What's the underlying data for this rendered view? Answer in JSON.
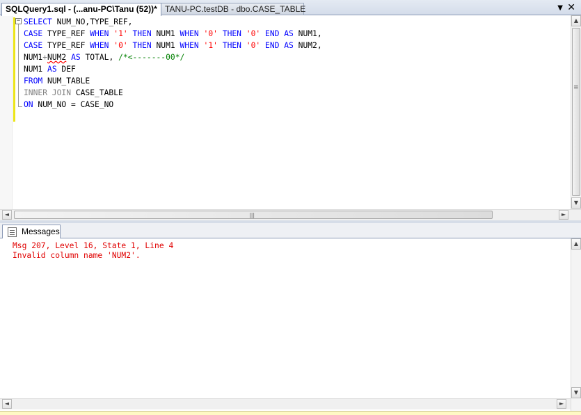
{
  "tabs": {
    "active_label": "SQLQuery1.sql - (...anu-PC\\Tanu (52))*",
    "inactive_label": "TANU-PC.testDB - dbo.CASE_TABLE",
    "dropdown_icon": "chevron-down-icon",
    "close_icon": "close-icon"
  },
  "editor": {
    "outline_glyph": "−",
    "lines": [
      [
        {
          "t": "SELECT",
          "c": "kw"
        },
        {
          "t": " NUM_NO,TYPE_REF,",
          "c": "plain"
        }
      ],
      [
        {
          "t": "CASE",
          "c": "kw"
        },
        {
          "t": " TYPE_REF ",
          "c": "plain"
        },
        {
          "t": "WHEN",
          "c": "kw"
        },
        {
          "t": " ",
          "c": "plain"
        },
        {
          "t": "'1'",
          "c": "str"
        },
        {
          "t": " ",
          "c": "plain"
        },
        {
          "t": "THEN",
          "c": "kw"
        },
        {
          "t": " NUM1 ",
          "c": "plain"
        },
        {
          "t": "WHEN",
          "c": "kw"
        },
        {
          "t": " ",
          "c": "plain"
        },
        {
          "t": "'0'",
          "c": "str"
        },
        {
          "t": " ",
          "c": "plain"
        },
        {
          "t": "THEN",
          "c": "kw"
        },
        {
          "t": " ",
          "c": "plain"
        },
        {
          "t": "'0'",
          "c": "str"
        },
        {
          "t": " ",
          "c": "plain"
        },
        {
          "t": "END",
          "c": "kw"
        },
        {
          "t": " ",
          "c": "plain"
        },
        {
          "t": "AS",
          "c": "kw"
        },
        {
          "t": " NUM1,",
          "c": "plain"
        }
      ],
      [
        {
          "t": "CASE",
          "c": "kw"
        },
        {
          "t": " TYPE_REF ",
          "c": "plain"
        },
        {
          "t": "WHEN",
          "c": "kw"
        },
        {
          "t": " ",
          "c": "plain"
        },
        {
          "t": "'0'",
          "c": "str"
        },
        {
          "t": " ",
          "c": "plain"
        },
        {
          "t": "THEN",
          "c": "kw"
        },
        {
          "t": " NUM1 ",
          "c": "plain"
        },
        {
          "t": "WHEN",
          "c": "kw"
        },
        {
          "t": " ",
          "c": "plain"
        },
        {
          "t": "'1'",
          "c": "str"
        },
        {
          "t": " ",
          "c": "plain"
        },
        {
          "t": "THEN",
          "c": "kw"
        },
        {
          "t": " ",
          "c": "plain"
        },
        {
          "t": "'0'",
          "c": "str"
        },
        {
          "t": " ",
          "c": "plain"
        },
        {
          "t": "END",
          "c": "kw"
        },
        {
          "t": " ",
          "c": "plain"
        },
        {
          "t": "AS",
          "c": "kw"
        },
        {
          "t": " NUM2,",
          "c": "plain"
        }
      ],
      [
        {
          "t": "NUM1",
          "c": "plain"
        },
        {
          "t": "+",
          "c": "gray"
        },
        {
          "t": "NUM2",
          "c": "plain squig"
        },
        {
          "t": " ",
          "c": "plain"
        },
        {
          "t": "AS",
          "c": "kw"
        },
        {
          "t": " TOTAL, ",
          "c": "plain"
        },
        {
          "t": "/*<-------00*/",
          "c": "cmt"
        }
      ],
      [
        {
          "t": "NUM1 ",
          "c": "plain"
        },
        {
          "t": "AS",
          "c": "kw"
        },
        {
          "t": " DEF",
          "c": "plain"
        }
      ],
      [
        {
          "t": "FROM",
          "c": "kw"
        },
        {
          "t": " NUM_TABLE",
          "c": "plain"
        }
      ],
      [
        {
          "t": "INNER JOIN",
          "c": "gray"
        },
        {
          "t": " CASE_TABLE",
          "c": "plain"
        }
      ],
      [
        {
          "t": "ON",
          "c": "kw"
        },
        {
          "t": " NUM_NO = CASE_NO",
          "c": "plain"
        }
      ]
    ]
  },
  "scrollbars": {
    "up_arrow": "▲",
    "down_arrow": "▼",
    "left_arrow": "◄",
    "right_arrow": "►",
    "grip": "≡",
    "hgrip": "|||"
  },
  "results": {
    "tab_label": "Messages",
    "tab_icon": "messages-icon",
    "lines": [
      "Msg 207, Level 16, State 1, Line 4",
      "Invalid column name 'NUM2'."
    ]
  },
  "colors": {
    "keyword": "#0000ff",
    "string": "#ff0000",
    "comment": "#008000",
    "error_text": "#e00000",
    "change_bar": "#ece51a"
  }
}
